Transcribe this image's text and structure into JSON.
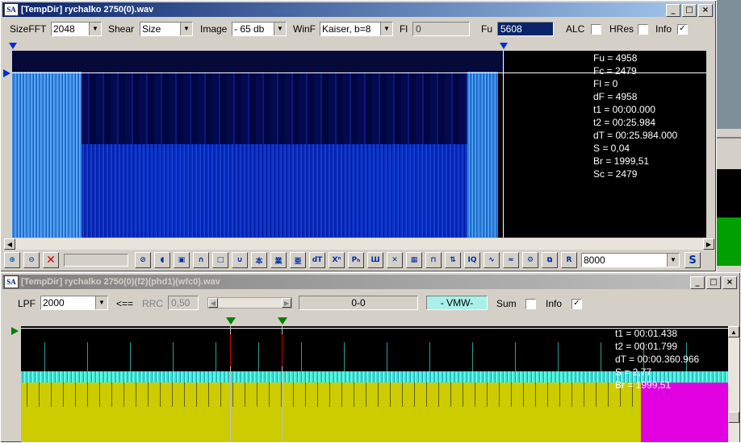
{
  "window1": {
    "title": "[TempDir] rychalko 2750(0).wav",
    "sizefft_label": "SizeFFT",
    "sizefft_value": "2048",
    "shear_label": "Shear",
    "shear_value": "Size",
    "image_label": "Image",
    "image_value": "- 65 db",
    "winf_label": "WinF",
    "winf_value": "Kaiser, b=8",
    "fl_label": "Fl",
    "fl_value": "0",
    "fu_label": "Fu",
    "fu_value": "5608",
    "alc_label": "ALC",
    "hres_label": "HRes",
    "info_label": "Info",
    "info_checked": "✓",
    "info_lines": [
      "Fu = 4958",
      "Fc = 2479",
      "Fl = 0",
      "dF = 4958",
      "t1 = 00:00.000",
      "t2 = 00:25.984",
      "dT = 00:25.984.000",
      "S = 0,04",
      "Br = 1999,51",
      "Sc = 2479"
    ],
    "toolbar_icons": [
      "circle-slash",
      "speaker",
      "stop",
      "arc-up",
      "rect",
      "arc-down",
      "filter-a",
      "filter-b",
      "filter-c",
      "dT",
      "X^n",
      "Ph",
      "comb",
      "cross",
      "grid",
      "square-wave",
      "fft-arrows",
      "IQ",
      "wave-a",
      "wave-b",
      "gear",
      "copy",
      "R"
    ],
    "toolbar_labels": {
      "dT": "dT",
      "Xn": "Xⁿ",
      "Ph": "Pₕ",
      "IQ": "IQ",
      "R": "R"
    },
    "rate_value": "8000",
    "s_button": "S"
  },
  "window2": {
    "title": "[TempDir] rychalko 2750(0)(f2)(phd1)(wfc0).wav",
    "lpf_label": "LPF",
    "lpf_value": "2000",
    "arrow_label": "<==",
    "rrc_label": "RRC",
    "rrc_value": "0,50",
    "offset_value": "0-0",
    "mode_value": "- VMW-",
    "sum_label": "Sum",
    "info_label": "Info",
    "info_checked": "✓",
    "info_lines": [
      "t1 = 00:01.438",
      "t2 = 00:01.799",
      "dT = 00:00.360.966",
      "S = 2,77",
      "Br = 1999,51"
    ]
  },
  "colors": {
    "titlebar_active": "#0a246a",
    "spectrum_bg": "#000000",
    "plot_yellow": "#cccc00",
    "plot_magenta": "#e000e0",
    "trace_cyan": "#40e0d0"
  }
}
